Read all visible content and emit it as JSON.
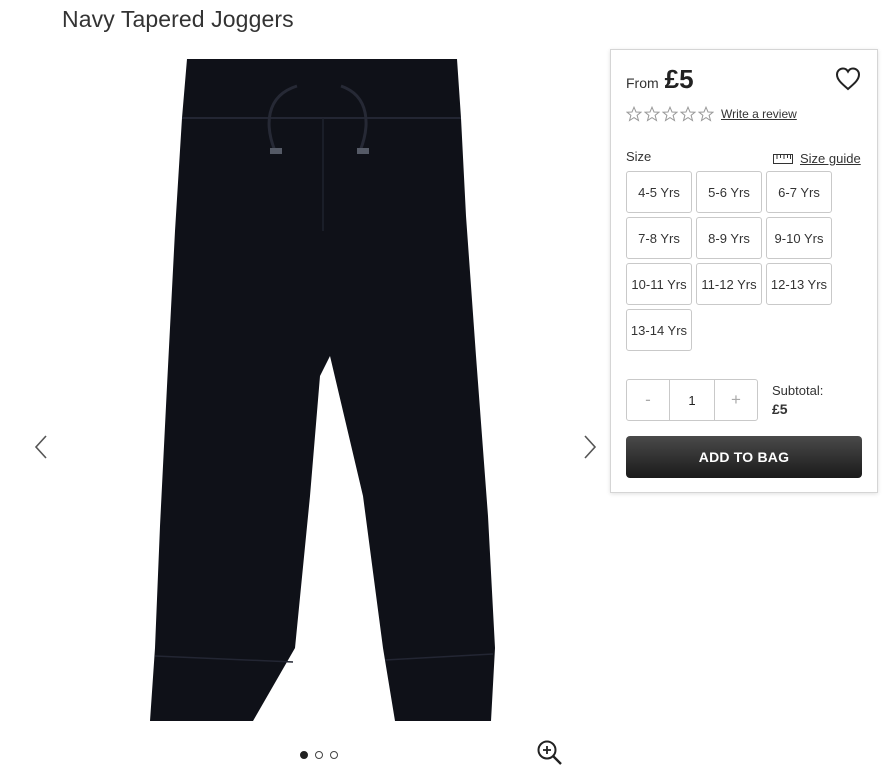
{
  "product": {
    "title": "Navy Tapered Joggers"
  },
  "gallery": {
    "prev_icon": "chevron-left-icon",
    "next_icon": "chevron-right-icon",
    "zoom_icon": "zoom-in-icon",
    "image_count": 3,
    "active_image": 1,
    "image_color": "#0f1118"
  },
  "panel": {
    "from_label": "From",
    "price": "£5",
    "wishlist_icon": "heart-icon",
    "rating": {
      "stars_filled": 0,
      "stars_total": 5,
      "review_link": "Write a review"
    },
    "size_label": "Size",
    "size_guide_icon": "ruler-icon",
    "size_guide_link": "Size guide",
    "sizes": [
      "4-5 Yrs",
      "5-6 Yrs",
      "6-7 Yrs",
      "7-8 Yrs",
      "8-9 Yrs",
      "9-10 Yrs",
      "10-11 Yrs",
      "11-12 Yrs",
      "12-13 Yrs",
      "13-14 Yrs"
    ],
    "quantity": {
      "decrement": "-",
      "value": "1",
      "increment": "+"
    },
    "subtotal_label": "Subtotal:",
    "subtotal_value": "£5",
    "add_to_bag": "ADD TO BAG"
  }
}
